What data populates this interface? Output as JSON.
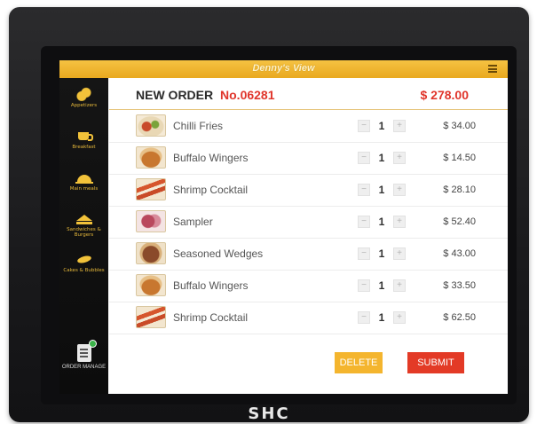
{
  "device": {
    "brand": "SHC"
  },
  "topbar": {
    "title": "Denny's View",
    "menu_icon": "hamburger-menu-icon"
  },
  "sidebar": {
    "categories": [
      {
        "label": "Appetizers",
        "icon": "shrimp-icon"
      },
      {
        "label": "Breakfast",
        "icon": "coffee-cup-icon"
      },
      {
        "label": "Main meals",
        "icon": "cloche-icon"
      },
      {
        "label": "Sandwiches & Burgers",
        "icon": "sandwich-icon"
      },
      {
        "label": "Cakes & Bubbles",
        "icon": "pasta-icon"
      }
    ],
    "order_manage": {
      "label": "ORDER MANAGE",
      "icon": "clipboard-icon"
    }
  },
  "order": {
    "title": "NEW ORDER",
    "number": "No.06281",
    "total": "$ 278.00",
    "items": [
      {
        "name": "Chilli Fries",
        "qty": "1",
        "price": "$ 34.00"
      },
      {
        "name": "Buffalo Wingers",
        "qty": "1",
        "price": "$ 14.50"
      },
      {
        "name": "Shrimp Cocktail",
        "qty": "1",
        "price": "$ 28.10"
      },
      {
        "name": "Sampler",
        "qty": "1",
        "price": "$ 52.40"
      },
      {
        "name": "Seasoned Wedges",
        "qty": "1",
        "price": "$ 43.00"
      },
      {
        "name": "Buffalo Wingers",
        "qty": "1",
        "price": "$ 33.50"
      },
      {
        "name": "Shrimp Cocktail",
        "qty": "1",
        "price": "$ 62.50"
      }
    ]
  },
  "actions": {
    "delete_label": "DELETE",
    "submit_label": "SUBMIT"
  },
  "colors": {
    "accent": "#f0b429",
    "danger": "#e33a26",
    "sidebar": "#111111"
  }
}
